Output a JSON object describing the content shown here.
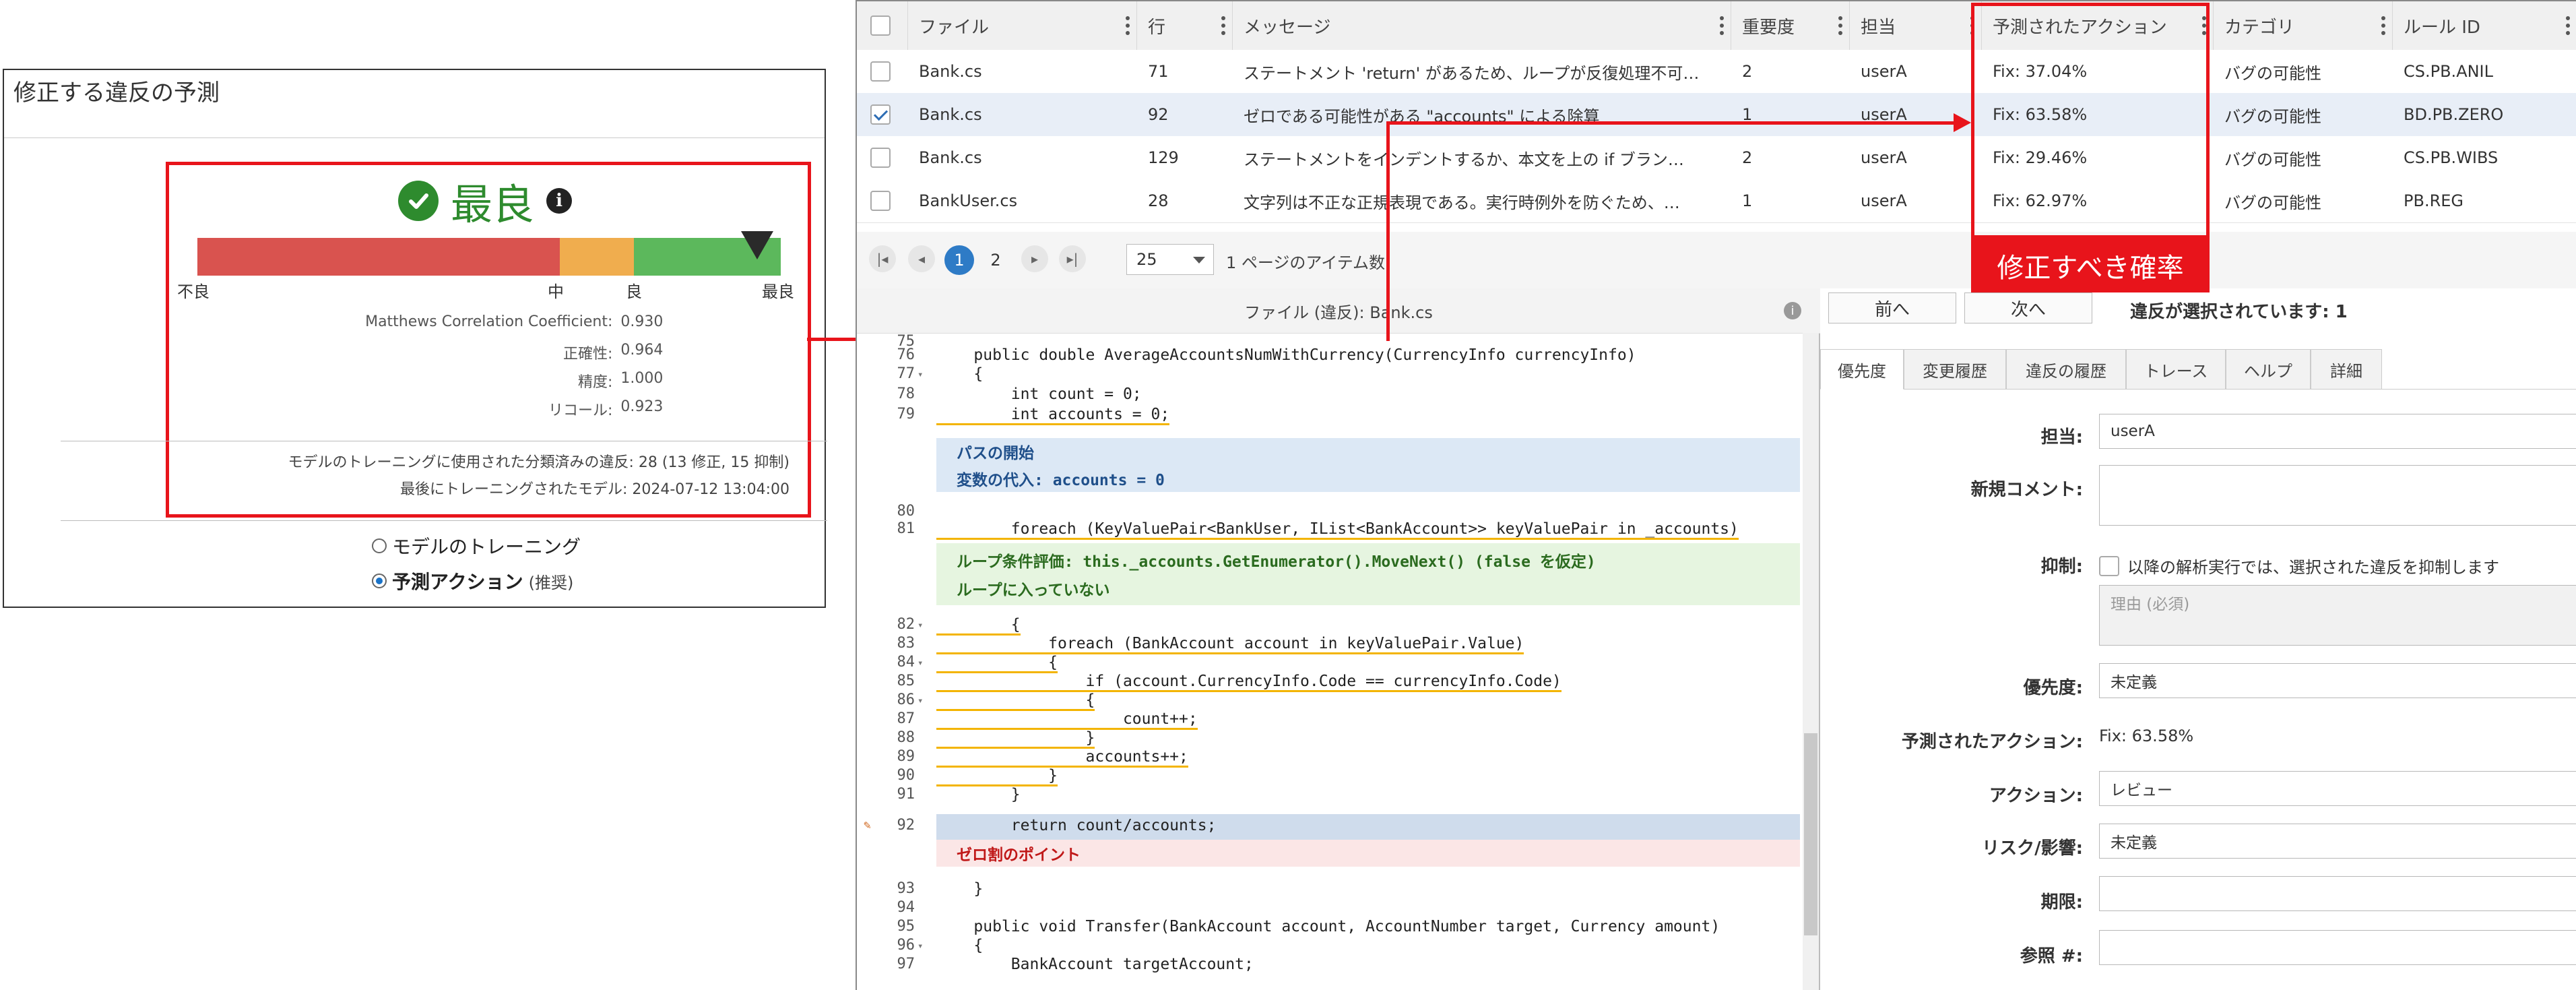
{
  "left": {
    "title": "修正する違反の予測",
    "status_label": "最良",
    "gauge": {
      "colors": [
        "#d9534f",
        "#f0ad4e",
        "#5cb85c"
      ],
      "ticks": [
        "不良",
        "中",
        "良",
        "最良"
      ],
      "pointer_fraction": 0.96
    },
    "metrics": [
      {
        "label": "Matthews Correlation Coefficient:",
        "value": "0.930"
      },
      {
        "label": "正確性:",
        "value": "0.964"
      },
      {
        "label": "精度:",
        "value": "1.000"
      },
      {
        "label": "リコール:",
        "value": "0.923"
      }
    ],
    "training_info": "モデルのトレーニングに使用された分類済みの違反: 28 (13 修正, 15 抑制)",
    "last_model": "最後にトレーニングされたモデル: 2024-07-12 13:04:00",
    "radio_train": "モデルのトレーニング",
    "radio_predict": "予測アクション",
    "radio_predict_note": "(推奨)"
  },
  "callout": "修正すべき確率",
  "grid": {
    "headers": [
      "ファイル",
      "行",
      "メッセージ",
      "重要度",
      "担当",
      "予測されたアクション",
      "カテゴリ",
      "ルール ID"
    ],
    "rows": [
      {
        "checked": false,
        "file": "Bank.cs",
        "line": "71",
        "message": "ステートメント 'return' があるため、ループが反復処理不可…",
        "severity": "2",
        "owner": "userA",
        "action": "Fix: 37.04%",
        "category": "バグの可能性",
        "rule": "CS.PB.ANIL"
      },
      {
        "checked": true,
        "file": "Bank.cs",
        "line": "92",
        "message": "ゼロである可能性がある \"accounts\" による除算",
        "severity": "1",
        "owner": "userA",
        "action": "Fix: 63.58%",
        "category": "バグの可能性",
        "rule": "BD.PB.ZERO"
      },
      {
        "checked": false,
        "file": "Bank.cs",
        "line": "129",
        "message": "ステートメントをインデントするか、本文を上の if ブラン…",
        "severity": "2",
        "owner": "userA",
        "action": "Fix: 29.46%",
        "category": "バグの可能性",
        "rule": "CS.PB.WIBS"
      },
      {
        "checked": false,
        "file": "BankUser.cs",
        "line": "28",
        "message": "文字列は不正な正規表現である。実行時例外を防ぐため、…",
        "severity": "1",
        "owner": "userA",
        "action": "Fix: 62.97%",
        "category": "バグの可能性",
        "rule": "PB.REG"
      }
    ]
  },
  "pager": {
    "pages": [
      "1",
      "2"
    ],
    "page_size": "25",
    "items_text": "1 ページのアイテム数"
  },
  "code": {
    "title": "ファイル (違反): Bank.cs",
    "lines": [
      {
        "n": "75",
        "fold": "",
        "text": ""
      },
      {
        "n": "76",
        "fold": "",
        "text": "    public double AverageAccountsNumWithCurrency(CurrencyInfo currencyInfo)"
      },
      {
        "n": "77",
        "fold": "▾",
        "text": "    {"
      },
      {
        "n": "78",
        "fold": "",
        "text": "        int count = 0;"
      },
      {
        "n": "79",
        "fold": "",
        "text": "        int accounts = 0;"
      },
      {
        "n": "80",
        "fold": "",
        "text": ""
      },
      {
        "n": "81",
        "fold": "",
        "text": "        foreach (KeyValuePair<BankUser, IList<BankAccount>> keyValuePair in _accounts)"
      },
      {
        "n": "82",
        "fold": "▾",
        "text": "        {"
      },
      {
        "n": "83",
        "fold": "",
        "text": "            foreach (BankAccount account in keyValuePair.Value)"
      },
      {
        "n": "84",
        "fold": "▾",
        "text": "            {"
      },
      {
        "n": "85",
        "fold": "",
        "text": "                if (account.CurrencyInfo.Code == currencyInfo.Code)"
      },
      {
        "n": "86",
        "fold": "▾",
        "text": "                {"
      },
      {
        "n": "87",
        "fold": "",
        "text": "                    count++;"
      },
      {
        "n": "88",
        "fold": "",
        "text": "                }"
      },
      {
        "n": "89",
        "fold": "",
        "text": "                accounts++;"
      },
      {
        "n": "90",
        "fold": "",
        "text": "            }"
      },
      {
        "n": "91",
        "fold": "",
        "text": "        }"
      },
      {
        "n": "92",
        "fold": "",
        "text": "        return count/accounts;"
      },
      {
        "n": "93",
        "fold": "",
        "text": "    }"
      },
      {
        "n": "94",
        "fold": "",
        "text": ""
      },
      {
        "n": "95",
        "fold": "",
        "text": "    public void Transfer(BankAccount account, AccountNumber target, Currency amount)"
      },
      {
        "n": "96",
        "fold": "▾",
        "text": "    {"
      },
      {
        "n": "97",
        "fold": "",
        "text": "        BankAccount targetAccount;"
      }
    ],
    "annotations": {
      "path_start": "パスの開始",
      "var_assign": "変数の代入: accounts = 0",
      "loop_eval": "ループ条件評価: this._accounts.GetEnumerator().MoveNext() (false を仮定)",
      "loop_not_entered": "ループに入っていない",
      "div_zero": "ゼロ割のポイント"
    }
  },
  "detail": {
    "prev": "前へ",
    "next": "次へ",
    "selected_text": "違反が選択されています: 1",
    "tabs": [
      "優先度",
      "変更履歴",
      "違反の履歴",
      "トレース",
      "ヘルプ",
      "詳細"
    ],
    "fields": {
      "owner_label": "担当:",
      "owner_value": "userA",
      "comment_label": "新規コメント:",
      "suppress_label": "抑制:",
      "suppress_text": "以降の解析実行では、選択された違反を抑制します",
      "reason_placeholder": "理由 (必須)",
      "priority_label": "優先度:",
      "priority_value": "未定義",
      "predicted_label": "予測されたアクション:",
      "predicted_value": "Fix: 63.58%",
      "action_label": "アクション:",
      "action_value": "レビュー",
      "risk_label": "リスク/影響:",
      "risk_value": "未定義",
      "deadline_label": "期限:",
      "ref_label": "参照 #:"
    }
  }
}
